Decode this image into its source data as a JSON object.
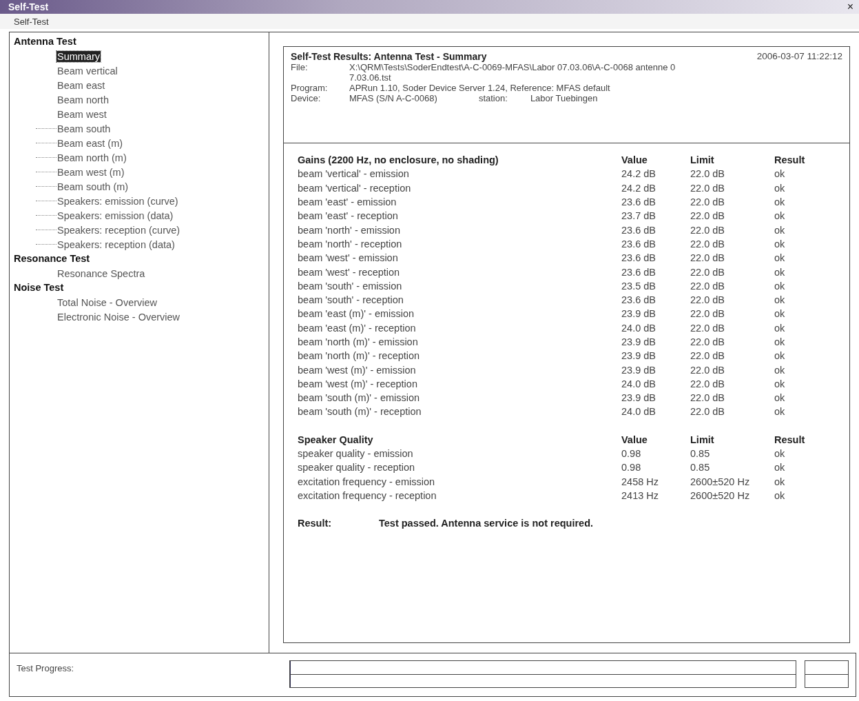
{
  "window": {
    "title": "Self-Test",
    "close": "×"
  },
  "menu": [
    "Self-Test"
  ],
  "tree": [
    {
      "label": "Antenna Test",
      "selected": false,
      "children": [
        {
          "label": "Summary",
          "selected": true,
          "leader": false
        },
        {
          "label": "Beam vertical",
          "selected": false,
          "leader": false
        },
        {
          "label": "Beam east",
          "selected": false,
          "leader": false
        },
        {
          "label": "Beam north",
          "selected": false,
          "leader": false
        },
        {
          "label": "Beam west",
          "selected": false,
          "leader": false
        },
        {
          "label": "Beam south",
          "selected": false,
          "leader": true
        },
        {
          "label": "Beam east (m)",
          "selected": false,
          "leader": true
        },
        {
          "label": "Beam north (m)",
          "selected": false,
          "leader": true
        },
        {
          "label": "Beam west (m)",
          "selected": false,
          "leader": true
        },
        {
          "label": "Beam south (m)",
          "selected": false,
          "leader": true
        },
        {
          "label": "Speakers: emission (curve)",
          "selected": false,
          "leader": true
        },
        {
          "label": "Speakers: emission (data)",
          "selected": false,
          "leader": true
        },
        {
          "label": "Speakers: reception (curve)",
          "selected": false,
          "leader": true
        },
        {
          "label": "Speakers: reception (data)",
          "selected": false,
          "leader": true
        }
      ]
    },
    {
      "label": "Resonance Test",
      "selected": false,
      "children": [
        {
          "label": "Resonance Spectra",
          "selected": false,
          "leader": false
        }
      ]
    },
    {
      "label": "Noise Test",
      "selected": false,
      "children": [
        {
          "label": "Total Noise - Overview",
          "selected": false,
          "leader": false
        },
        {
          "label": "Electronic Noise - Overview",
          "selected": false,
          "leader": false
        }
      ]
    }
  ],
  "report": {
    "title": "Self-Test Results: Antenna Test - Summary",
    "timestamp": "2006-03-07 11:22:12",
    "info": [
      {
        "label": "File:",
        "value": "X:\\QRM\\Tests\\SoderEndtest\\A-C-0069-MFAS\\Labor 07.03.06\\A-C-0068 antenne 07.03.06.tst"
      },
      {
        "label": "Program:",
        "value": "APRun 1.10, Soder Device Server 1.24, Reference: MFAS default"
      },
      {
        "label": "Device:",
        "value": "MFAS (S/N A-C-0068)",
        "extra_label": "station:",
        "extra_value": "Labor Tuebingen"
      }
    ],
    "sections": [
      {
        "columns": [
          "Gains (2200 Hz, no enclosure, no shading)",
          "Value",
          "Limit",
          "Result"
        ],
        "rows": [
          [
            "beam 'vertical' - emission",
            "24.2 dB",
            "22.0 dB",
            "ok"
          ],
          [
            "beam 'vertical' - reception",
            "24.2 dB",
            "22.0 dB",
            "ok"
          ],
          [
            "beam 'east' - emission",
            "23.6 dB",
            "22.0 dB",
            "ok"
          ],
          [
            "beam 'east' - reception",
            "23.7 dB",
            "22.0 dB",
            "ok"
          ],
          [
            "beam 'north' - emission",
            "23.6 dB",
            "22.0 dB",
            "ok"
          ],
          [
            "beam 'north' - reception",
            "23.6 dB",
            "22.0 dB",
            "ok"
          ],
          [
            "beam 'west' - emission",
            "23.6 dB",
            "22.0 dB",
            "ok"
          ],
          [
            "beam 'west' - reception",
            "23.6 dB",
            "22.0 dB",
            "ok"
          ],
          [
            "beam 'south' - emission",
            "23.5 dB",
            "22.0 dB",
            "ok"
          ],
          [
            "beam 'south' - reception",
            "23.6 dB",
            "22.0 dB",
            "ok"
          ],
          [
            "beam 'east (m)' - emission",
            "23.9 dB",
            "22.0 dB",
            "ok"
          ],
          [
            "beam 'east (m)' - reception",
            "24.0 dB",
            "22.0 dB",
            "ok"
          ],
          [
            "beam 'north (m)' - emission",
            "23.9 dB",
            "22.0 dB",
            "ok"
          ],
          [
            "beam 'north (m)' - reception",
            "23.9 dB",
            "22.0 dB",
            "ok"
          ],
          [
            "beam 'west (m)' - emission",
            "23.9 dB",
            "22.0 dB",
            "ok"
          ],
          [
            "beam 'west (m)' - reception",
            "24.0 dB",
            "22.0 dB",
            "ok"
          ],
          [
            "beam 'south (m)' - emission",
            "23.9 dB",
            "22.0 dB",
            "ok"
          ],
          [
            "beam 'south (m)' - reception",
            "24.0 dB",
            "22.0 dB",
            "ok"
          ]
        ]
      },
      {
        "columns": [
          "Speaker Quality",
          "Value",
          "Limit",
          "Result"
        ],
        "rows": [
          [
            "speaker quality - emission",
            "0.98",
            "0.85",
            "ok"
          ],
          [
            "speaker quality - reception",
            "0.98",
            "0.85",
            "ok"
          ],
          [
            "excitation frequency - emission",
            "2458 Hz",
            "2600±520 Hz",
            "ok"
          ],
          [
            "excitation frequency - reception",
            "2413 Hz",
            "2600±520 Hz",
            "ok"
          ]
        ]
      }
    ],
    "result_label": "Result:",
    "result_text": "Test passed. Antenna service is not required."
  },
  "status": {
    "label": "Test Progress:",
    "progress": {
      "level": 0
    }
  }
}
